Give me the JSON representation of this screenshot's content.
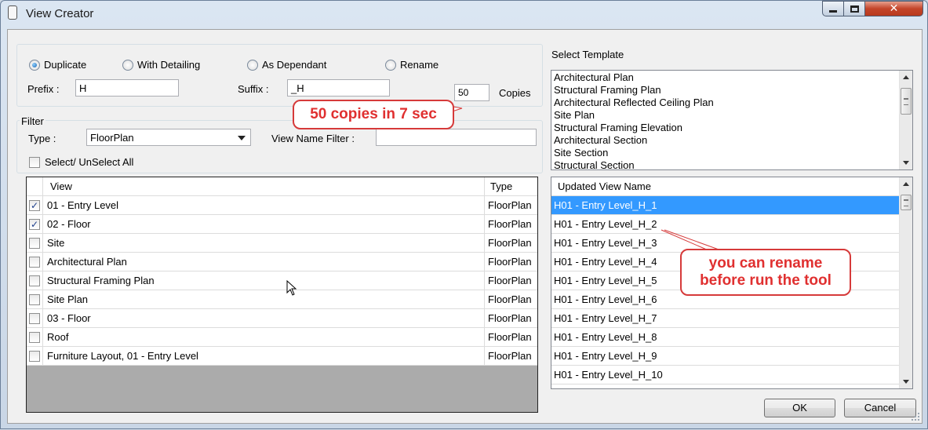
{
  "window": {
    "title": "View Creator"
  },
  "options": {
    "duplicate": "Duplicate",
    "with_detailing": "With Detailing",
    "as_dependant": "As Dependant",
    "rename": "Rename",
    "selected": "duplicate",
    "prefix_label": "Prefix :",
    "prefix_value": "H",
    "suffix_label": "Suffix :",
    "suffix_value": "_H",
    "copies_value": "50",
    "copies_label": "Copies"
  },
  "filter": {
    "group_label": "Filter",
    "type_label": "Type  :",
    "type_value": "FloorPlan",
    "name_filter_label": "View Name Filter :",
    "name_filter_value": "",
    "select_all_label": "Select/ UnSelect All"
  },
  "views_grid": {
    "columns": [
      "View",
      "Type"
    ],
    "rows": [
      {
        "checked": true,
        "view": "01 - Entry Level",
        "type": "FloorPlan"
      },
      {
        "checked": true,
        "view": "02 - Floor",
        "type": "FloorPlan"
      },
      {
        "checked": false,
        "view": "Site",
        "type": "FloorPlan"
      },
      {
        "checked": false,
        "view": "Architectural Plan",
        "type": "FloorPlan"
      },
      {
        "checked": false,
        "view": "Structural Framing Plan",
        "type": "FloorPlan"
      },
      {
        "checked": false,
        "view": "Site Plan",
        "type": "FloorPlan"
      },
      {
        "checked": false,
        "view": "03 - Floor",
        "type": "FloorPlan"
      },
      {
        "checked": false,
        "view": "Roof",
        "type": "FloorPlan"
      },
      {
        "checked": false,
        "view": "Furniture Layout,  01 - Entry Level",
        "type": "FloorPlan"
      }
    ]
  },
  "template": {
    "label": "Select Template",
    "items": [
      "Architectural Plan",
      "Structural Framing Plan",
      "Architectural Reflected Ceiling Plan",
      "Site Plan",
      "Structural Framing Elevation",
      "Architectural Section",
      "Site Section",
      "Structural Section"
    ]
  },
  "updated_grid": {
    "header": "Updated View Name",
    "selected_index": 0,
    "rows": [
      "H01 - Entry Level_H_1",
      "H01 - Entry Level_H_2",
      "H01 - Entry Level_H_3",
      "H01 - Entry Level_H_4",
      "H01 - Entry Level_H_5",
      "H01 - Entry Level_H_6",
      "H01 - Entry Level_H_7",
      "H01 - Entry Level_H_8",
      "H01 - Entry Level_H_9",
      "H01 - Entry Level_H_10"
    ]
  },
  "buttons": {
    "ok": "OK",
    "cancel": "Cancel"
  },
  "callouts": {
    "copies_note": "50 copies in 7 sec",
    "rename_note_line1": "you can rename",
    "rename_note_line2": "before run the tool"
  },
  "icons": {
    "minimize": "minimize-icon",
    "maximize": "maximize-icon",
    "close": "close-icon",
    "dropdown": "chevron-down-icon",
    "cursor": "mouse-cursor-icon"
  },
  "colors": {
    "selection": "#3399ff",
    "callout_border": "#d63a3a",
    "callout_text": "#e03030",
    "close_button": "#c4452a"
  }
}
